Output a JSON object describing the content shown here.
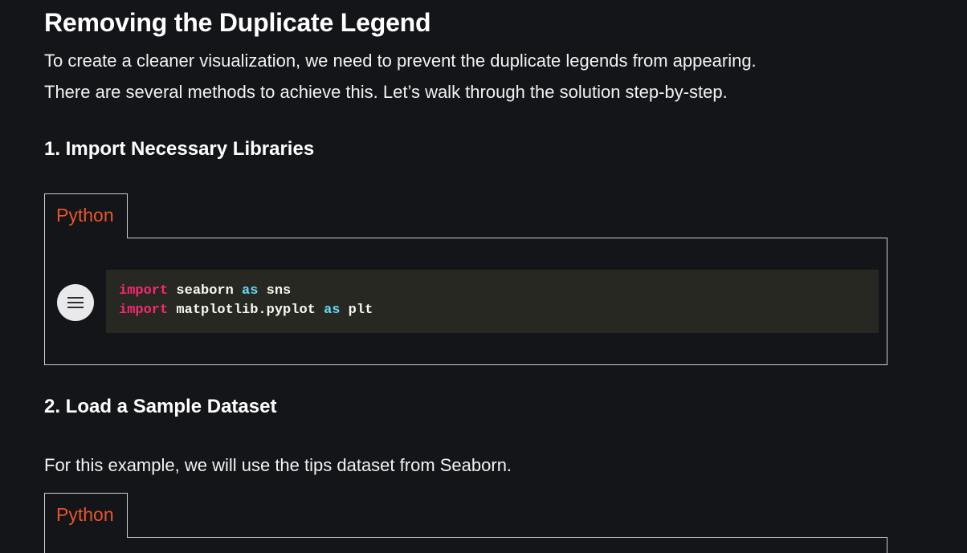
{
  "article": {
    "title": "Removing the Duplicate Legend",
    "intro_line1": "To create a cleaner visualization, we need to prevent the duplicate legends from appearing.",
    "intro_line2": "There are several methods to achieve this. Let’s walk through the solution step-by-step.",
    "step1_heading": "1. Import Necessary Libraries",
    "step2_heading": "2. Load a Sample Dataset",
    "step2_text": "For this example, we will use the tips dataset from Seaborn."
  },
  "code_blocks": [
    {
      "language": "Python",
      "lines": [
        {
          "kw": "import",
          "module": " seaborn ",
          "as": "as",
          "alias": " sns"
        },
        {
          "kw": "import",
          "module": " matplotlib.pyplot ",
          "as": "as",
          "alias": " plt"
        }
      ]
    },
    {
      "language": "Python"
    }
  ],
  "icons": {
    "menu": "hamburger-menu-icon"
  },
  "colors": {
    "background": "#141518",
    "tab_label": "#e8542d",
    "code_background": "#272822",
    "keyword": "#f92672",
    "keyword_as": "#66d9ef"
  }
}
